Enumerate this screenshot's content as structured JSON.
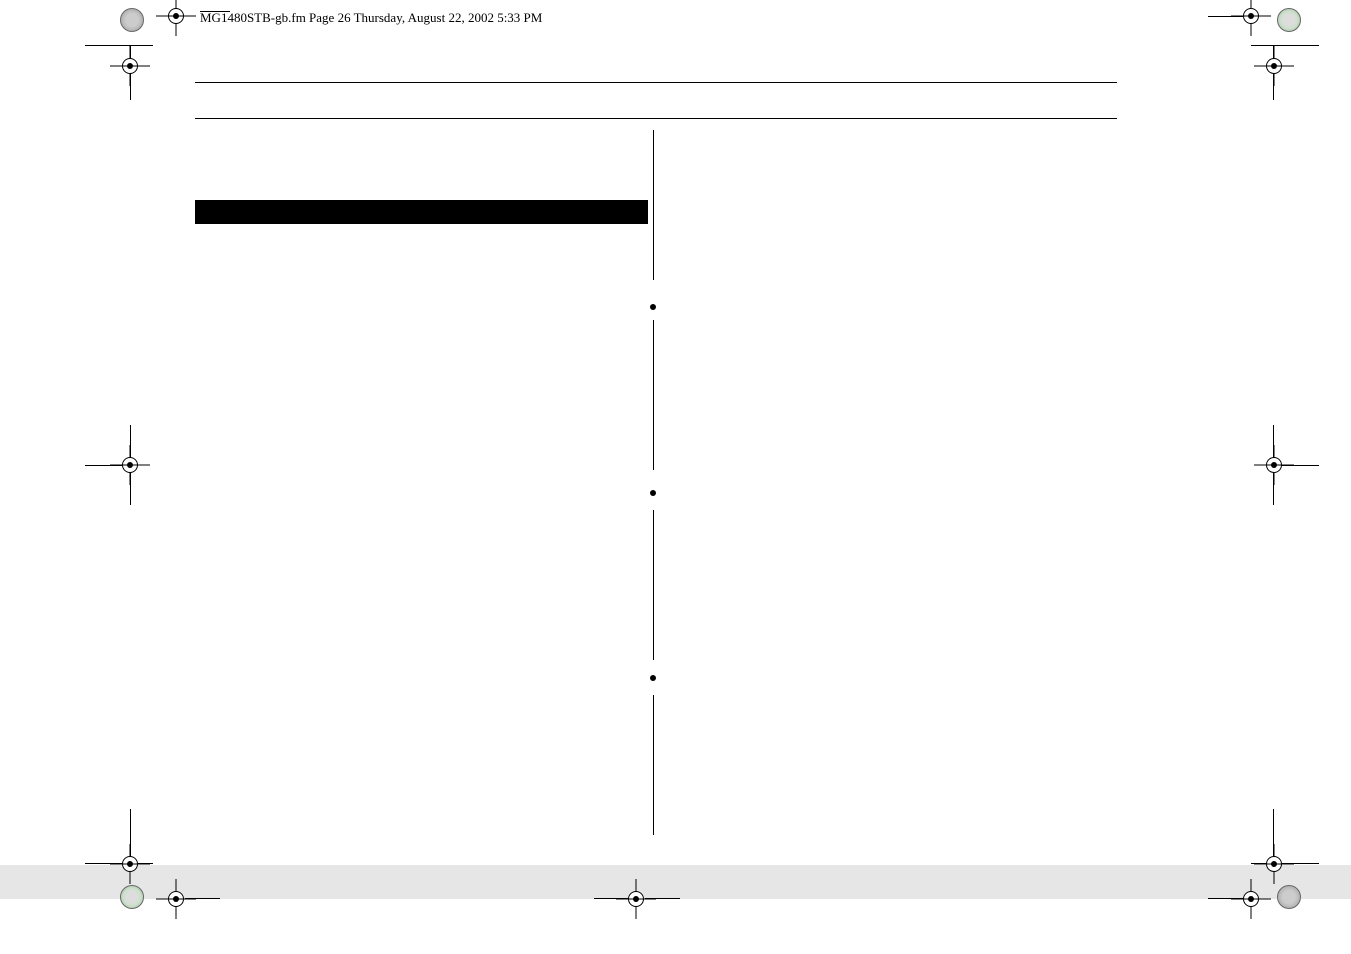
{
  "header": {
    "file_info": "MG1480STB-gb.fm Page 26 Thursday, August 22, 2002 5:33 PM"
  }
}
